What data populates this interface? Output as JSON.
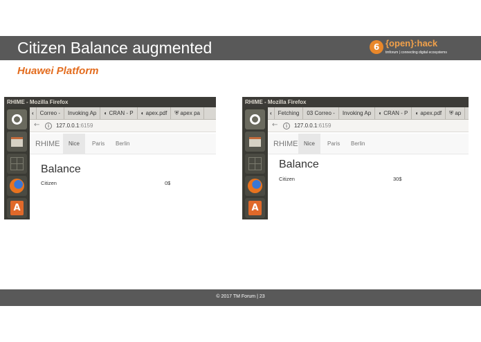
{
  "slide": {
    "title": "Citizen Balance augmented",
    "subtitle": "Huawei Platform",
    "footer": "© 2017 TM Forum   |   23"
  },
  "logo": {
    "badge": "6",
    "main": "{open}:hack",
    "sub": "tmforum | connecting digital ecosystems"
  },
  "colors": {
    "title_bar": "#595959",
    "accent_orange": "#e36c1e",
    "window_titlebar": "#3c3b37",
    "launcher": "#3a3a34"
  },
  "left_browser": {
    "window_title": "RHIME - Mozilla Firefox",
    "tabs": [
      {
        "label": "‹"
      },
      {
        "label": "Correo -"
      },
      {
        "label": "Invoking Ap"
      },
      {
        "label": "◐ CRAN - P"
      },
      {
        "label": "◐ apex.pdf"
      },
      {
        "label": "⛨ apex pa"
      }
    ],
    "url_host": "127.0.0.1",
    "url_port": ":6159",
    "brand": "RHIME",
    "nav": [
      {
        "label": "Nice",
        "active": true
      },
      {
        "label": "Paris",
        "active": false
      },
      {
        "label": "Berlin",
        "active": false
      }
    ],
    "balance_title": "Balance",
    "row_label": "Citizen",
    "row_value": "0$"
  },
  "right_browser": {
    "window_title": "RHIME - Mozilla Firefox",
    "tabs": [
      {
        "label": "‹"
      },
      {
        "label": "Fetching"
      },
      {
        "label": "03 Correo -"
      },
      {
        "label": "Invoking Ap"
      },
      {
        "label": "◐ CRAN - P"
      },
      {
        "label": "◐ apex.pdf"
      },
      {
        "label": "⛨ ap"
      }
    ],
    "url_host": "127.0.0.1",
    "url_port": ":6159",
    "brand": "RHIME",
    "nav": [
      {
        "label": "Nice",
        "active": true
      },
      {
        "label": "Paris",
        "active": false
      },
      {
        "label": "Berlin",
        "active": false
      }
    ],
    "balance_title": "Balance",
    "row_label": "Citizen",
    "row_value": "30$"
  },
  "icons": {
    "back": "back-arrow-icon",
    "info": "info-icon",
    "launcher": [
      "ubuntu-dash-icon",
      "files-icon",
      "workspace-icon",
      "firefox-icon",
      "software-center-icon"
    ]
  }
}
